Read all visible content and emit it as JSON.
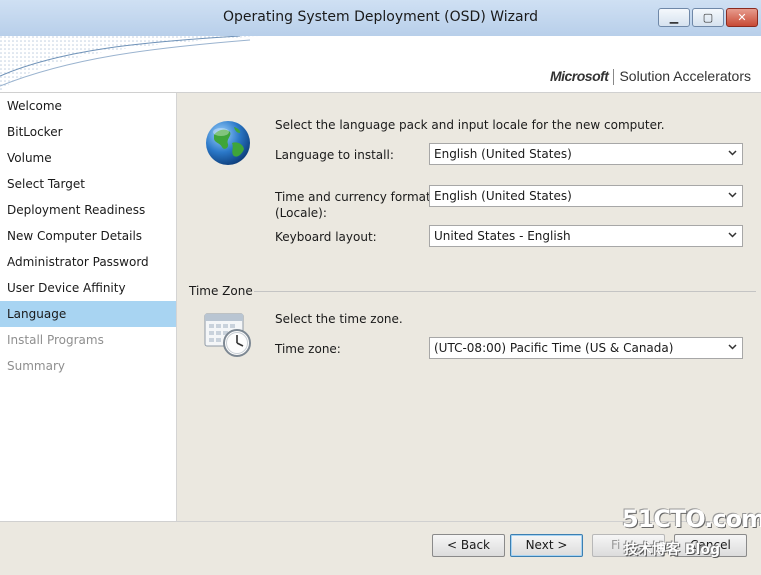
{
  "window": {
    "title": "Operating System Deployment (OSD) Wizard",
    "minimize_icon": "minimize-icon",
    "maximize_icon": "maximize-icon",
    "close_icon": "close-icon"
  },
  "banner": {
    "brand_name": "Microsoft",
    "brand_product": "Solution Accelerators"
  },
  "sidebar": {
    "items": [
      {
        "label": "Welcome",
        "state": "normal"
      },
      {
        "label": "BitLocker",
        "state": "normal"
      },
      {
        "label": "Volume",
        "state": "normal"
      },
      {
        "label": "Select Target",
        "state": "normal"
      },
      {
        "label": "Deployment Readiness",
        "state": "normal"
      },
      {
        "label": "New Computer Details",
        "state": "normal"
      },
      {
        "label": "Administrator Password",
        "state": "normal"
      },
      {
        "label": "User Device Affinity",
        "state": "normal"
      },
      {
        "label": "Language",
        "state": "active"
      },
      {
        "label": "Install Programs",
        "state": "disabled"
      },
      {
        "label": "Summary",
        "state": "disabled"
      }
    ]
  },
  "language_section": {
    "icon": "globe-icon",
    "instruction": "Select the language pack and input locale for the new computer.",
    "language_label": "Language to install:",
    "language_value": "English (United States)",
    "locale_label_line1": "Time and currency format",
    "locale_label_line2": "(Locale):",
    "locale_value": "English (United States)",
    "keyboard_label": "Keyboard layout:",
    "keyboard_value": "United States - English"
  },
  "timezone_section": {
    "heading": "Time Zone",
    "icon": "calendar-clock-icon",
    "instruction": "Select the time zone.",
    "timezone_label": "Time zone:",
    "timezone_value": "(UTC-08:00) Pacific Time (US & Canada)"
  },
  "buttons": {
    "back": "< Back",
    "next": "Next >",
    "finish": "Fi",
    "cancel": "Cancel"
  },
  "watermark": {
    "top": "51CTO.com",
    "bottom": "技术博客",
    "bottom_suffix": "Blog"
  },
  "colors": {
    "active_nav": "#a8d4f2",
    "content_bg": "#ebe8e0",
    "titlebar": "#c4d8ef"
  }
}
